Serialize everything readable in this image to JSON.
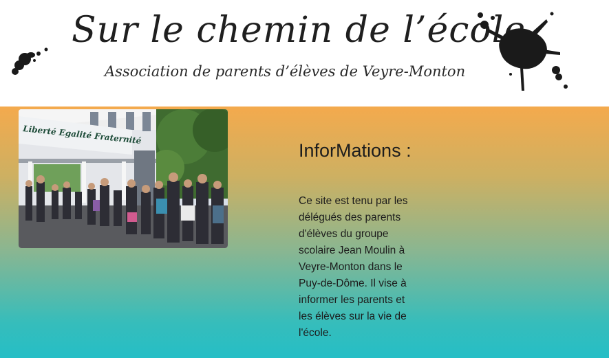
{
  "header": {
    "title": "Sur le chemin de l’école",
    "subtitle": "Association de parents d’élèves de Veyre-Monton"
  },
  "photo": {
    "sign_text": "Liberté Egalité Fraternité"
  },
  "info": {
    "title": "InforMations :",
    "body": "Ce site est tenu par les délégués des parents d'élèves du groupe scolaire Jean Moulin à Veyre-Monton dans le Puy-de-Dôme. Il vise à informer les parents et les élèves sur la vie de l'école."
  },
  "colors": {
    "gradient_top": "#f4aa4d",
    "gradient_bottom": "#25bec6",
    "ink": "#1a1a1a"
  }
}
